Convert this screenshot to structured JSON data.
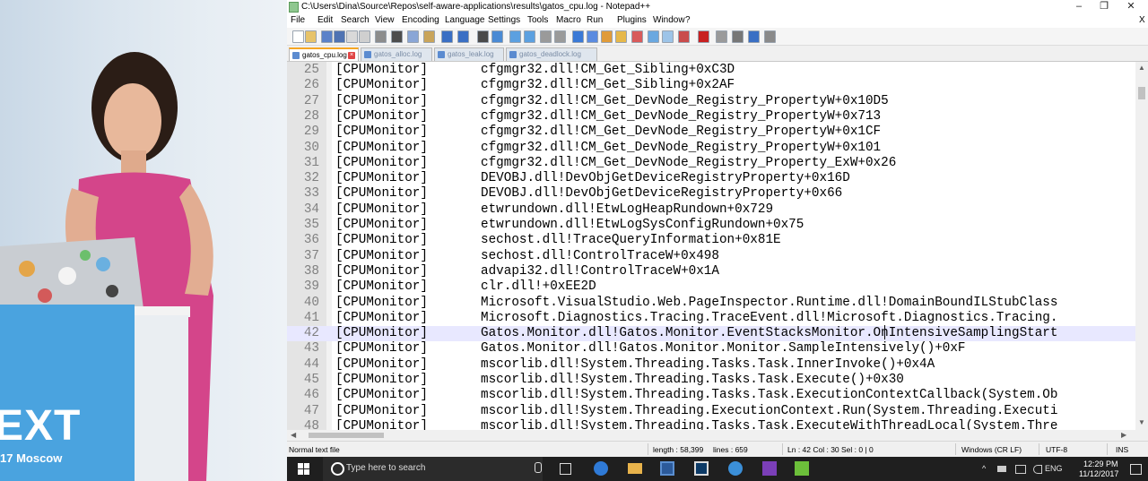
{
  "photo": {
    "banner_text": "EXT",
    "banner_subtext": "17 Moscow"
  },
  "window": {
    "title": "C:\\Users\\Dina\\Source\\Repos\\self-aware-applications\\results\\gatos_cpu.log - Notepad++",
    "minimize_glyph": "–",
    "maximize_glyph": "❐",
    "close_glyph": "✕",
    "menu_close_glyph": "X"
  },
  "menu": [
    "File",
    "Edit",
    "Search",
    "View",
    "Encoding",
    "Language",
    "Settings",
    "Tools",
    "Macro",
    "Run",
    "Plugins",
    "Window",
    "?"
  ],
  "toolbar_icons": [
    "new-icon",
    "open-icon",
    "save-icon",
    "save-all-icon",
    "close-icon",
    "close-all-icon",
    "print-icon",
    "cut-icon",
    "copy-icon",
    "paste-icon",
    "undo-icon",
    "redo-icon",
    "find-icon",
    "replace-icon",
    "zoom-in-icon",
    "zoom-out-icon",
    "sync-vertical-icon",
    "sync-horizontal-icon",
    "word-wrap-icon",
    "show-all-chars-icon",
    "indent-guide-icon",
    "user-language-icon",
    "doc-map-icon",
    "function-list-icon",
    "folder-workspace-icon",
    "monitoring-icon",
    "record-macro-icon",
    "stop-macro-icon",
    "play-macro-icon",
    "run-macro-multiple-icon",
    "save-macro-icon"
  ],
  "tabs": [
    {
      "label": "gatos_cpu.log",
      "active": true
    },
    {
      "label": "gatos_alloc.log",
      "active": false
    },
    {
      "label": "gatos_leak.log",
      "active": false
    },
    {
      "label": "gatos_deadlock.log",
      "active": false
    }
  ],
  "lines": [
    {
      "num": "25",
      "source": "[CPUMonitor]",
      "text": "cfgmgr32.dll!CM_Get_Sibling+0xC3D"
    },
    {
      "num": "26",
      "source": "[CPUMonitor]",
      "text": "cfgmgr32.dll!CM_Get_Sibling+0x2AF"
    },
    {
      "num": "27",
      "source": "[CPUMonitor]",
      "text": "cfgmgr32.dll!CM_Get_DevNode_Registry_PropertyW+0x10D5"
    },
    {
      "num": "28",
      "source": "[CPUMonitor]",
      "text": "cfgmgr32.dll!CM_Get_DevNode_Registry_PropertyW+0x713"
    },
    {
      "num": "29",
      "source": "[CPUMonitor]",
      "text": "cfgmgr32.dll!CM_Get_DevNode_Registry_PropertyW+0x1CF"
    },
    {
      "num": "30",
      "source": "[CPUMonitor]",
      "text": "cfgmgr32.dll!CM_Get_DevNode_Registry_PropertyW+0x101"
    },
    {
      "num": "31",
      "source": "[CPUMonitor]",
      "text": "cfgmgr32.dll!CM_Get_DevNode_Registry_Property_ExW+0x26"
    },
    {
      "num": "32",
      "source": "[CPUMonitor]",
      "text": "DEVOBJ.dll!DevObjGetDeviceRegistryProperty+0x16D"
    },
    {
      "num": "33",
      "source": "[CPUMonitor]",
      "text": "DEVOBJ.dll!DevObjGetDeviceRegistryProperty+0x66"
    },
    {
      "num": "34",
      "source": "[CPUMonitor]",
      "text": "etwrundown.dll!EtwLogHeapRundown+0x729"
    },
    {
      "num": "35",
      "source": "[CPUMonitor]",
      "text": "etwrundown.dll!EtwLogSysConfigRundown+0x75"
    },
    {
      "num": "36",
      "source": "[CPUMonitor]",
      "text": "sechost.dll!TraceQueryInformation+0x81E"
    },
    {
      "num": "37",
      "source": "[CPUMonitor]",
      "text": "sechost.dll!ControlTraceW+0x498"
    },
    {
      "num": "38",
      "source": "[CPUMonitor]",
      "text": "advapi32.dll!ControlTraceW+0x1A"
    },
    {
      "num": "39",
      "source": "[CPUMonitor]",
      "text": "clr.dll!+0xEE2D"
    },
    {
      "num": "40",
      "source": "[CPUMonitor]",
      "text": "Microsoft.VisualStudio.Web.PageInspector.Runtime.dll!DomainBoundILStubClass"
    },
    {
      "num": "41",
      "source": "[CPUMonitor]",
      "text": "Microsoft.Diagnostics.Tracing.TraceEvent.dll!Microsoft.Diagnostics.Tracing."
    },
    {
      "num": "42",
      "source": "[CPUMonitor]",
      "text": "Gatos.Monitor.dll!Gatos.Monitor.EventStacksMonitor.OnIntensiveSamplingStart"
    },
    {
      "num": "43",
      "source": "[CPUMonitor]",
      "text": "Gatos.Monitor.dll!Gatos.Monitor.Monitor.SampleIntensively()+0xF"
    },
    {
      "num": "44",
      "source": "[CPUMonitor]",
      "text": "mscorlib.dll!System.Threading.Tasks.Task.InnerInvoke()+0x4A"
    },
    {
      "num": "45",
      "source": "[CPUMonitor]",
      "text": "mscorlib.dll!System.Threading.Tasks.Task.Execute()+0x30"
    },
    {
      "num": "46",
      "source": "[CPUMonitor]",
      "text": "mscorlib.dll!System.Threading.Tasks.Task.ExecutionContextCallback(System.Ob"
    },
    {
      "num": "47",
      "source": "[CPUMonitor]",
      "text": "mscorlib.dll!System.Threading.ExecutionContext.Run(System.Threading.Executi"
    },
    {
      "num": "48",
      "source": "[CPUMonitor]",
      "text": "mscorlib.dll!System.Threading.Tasks.Task.ExecuteWithThreadLocal(System.Thre"
    }
  ],
  "current_line_index": 17,
  "status": {
    "file_type": "Normal text file",
    "length": "length : 58,399",
    "lines": "lines : 659",
    "position": "Ln : 42   Col : 30   Sel : 0 | 0",
    "eol": "Windows (CR LF)",
    "encoding": "UTF-8",
    "mode": "INS"
  },
  "taskbar": {
    "search_placeholder": "Type here to search",
    "language": "ENG",
    "time": "12:29 PM",
    "date": "11/12/2017",
    "tray_chevron": "^"
  },
  "colors": {
    "gutter_bg": "#e4e4e4",
    "current_line_bg": "#e8e8ff",
    "active_tab_accent": "#f5a623",
    "taskbar_bg": "#1f1f1f",
    "banner": "#4aa3df"
  }
}
